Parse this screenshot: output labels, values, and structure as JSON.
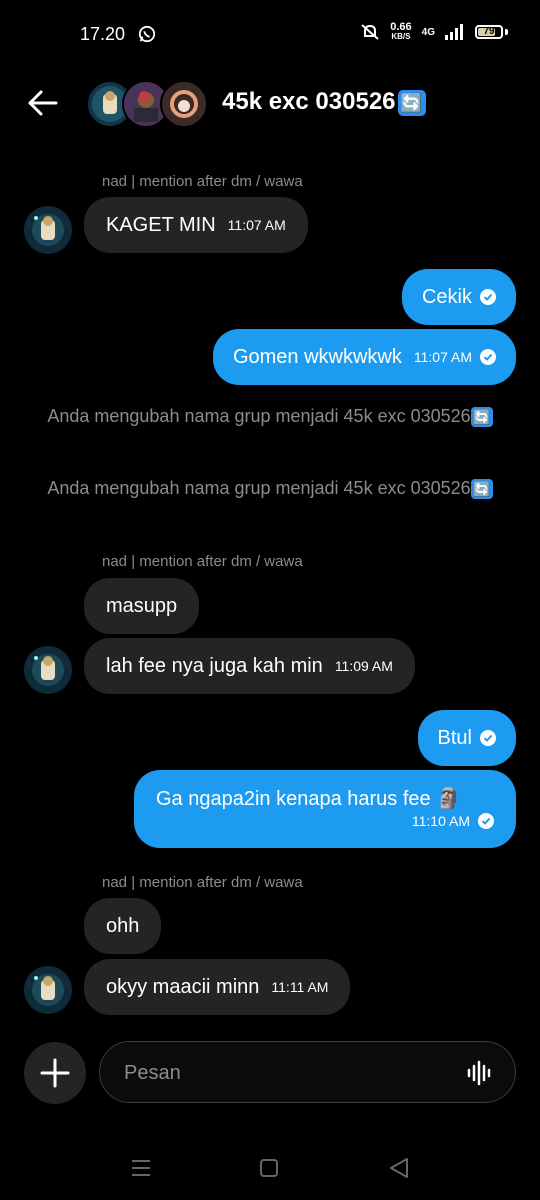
{
  "status_bar": {
    "time": "17.20",
    "speed_value": "0.66",
    "speed_unit": "KB/S",
    "network": "4G",
    "battery": "79",
    "battery_level": 0.79
  },
  "header": {
    "title": "45k exc 030526",
    "title_emoji": "🔄"
  },
  "messages": {
    "m1": {
      "sender": "nad | mention after dm / wawa",
      "text": "KAGET MIN",
      "time": "11:07 AM"
    },
    "m2": {
      "text": "Cekik"
    },
    "m3": {
      "text": "Gomen wkwkwkwk",
      "time": "11:07 AM"
    },
    "sys1": {
      "text": "Anda mengubah nama grup menjadi 45k exc 030526",
      "emoji": "🔄"
    },
    "sys2": {
      "text": "Anda mengubah nama grup menjadi 45k exc 030526",
      "emoji": "🔄"
    },
    "m4": {
      "sender": "nad | mention after dm / wawa",
      "text": "masupp"
    },
    "m5": {
      "text": "lah fee nya juga kah min",
      "time": "11:09 AM"
    },
    "m6": {
      "text": "Btul"
    },
    "m7": {
      "text": "Ga ngapa2in kenapa harus fee",
      "emoji": "🗿",
      "time": "11:10 AM"
    },
    "m8": {
      "sender": "nad | mention after dm / wawa",
      "text": "ohh"
    },
    "m9": {
      "text": "okyy maacii minn",
      "time": "11:11 AM"
    }
  },
  "composer": {
    "placeholder": "Pesan"
  },
  "colors": {
    "background": "#000000",
    "outgoing_bubble": "#1d9bf0",
    "incoming_bubble": "#242424",
    "muted_text": "#8c8c8c"
  },
  "icons": {
    "back": "arrow-left-icon",
    "plus": "plus-icon",
    "voice": "waveform-icon",
    "read": "check-circle-icon",
    "nav_recents": "menu-lines-icon",
    "nav_home": "square-icon",
    "nav_back": "triangle-back-icon"
  }
}
